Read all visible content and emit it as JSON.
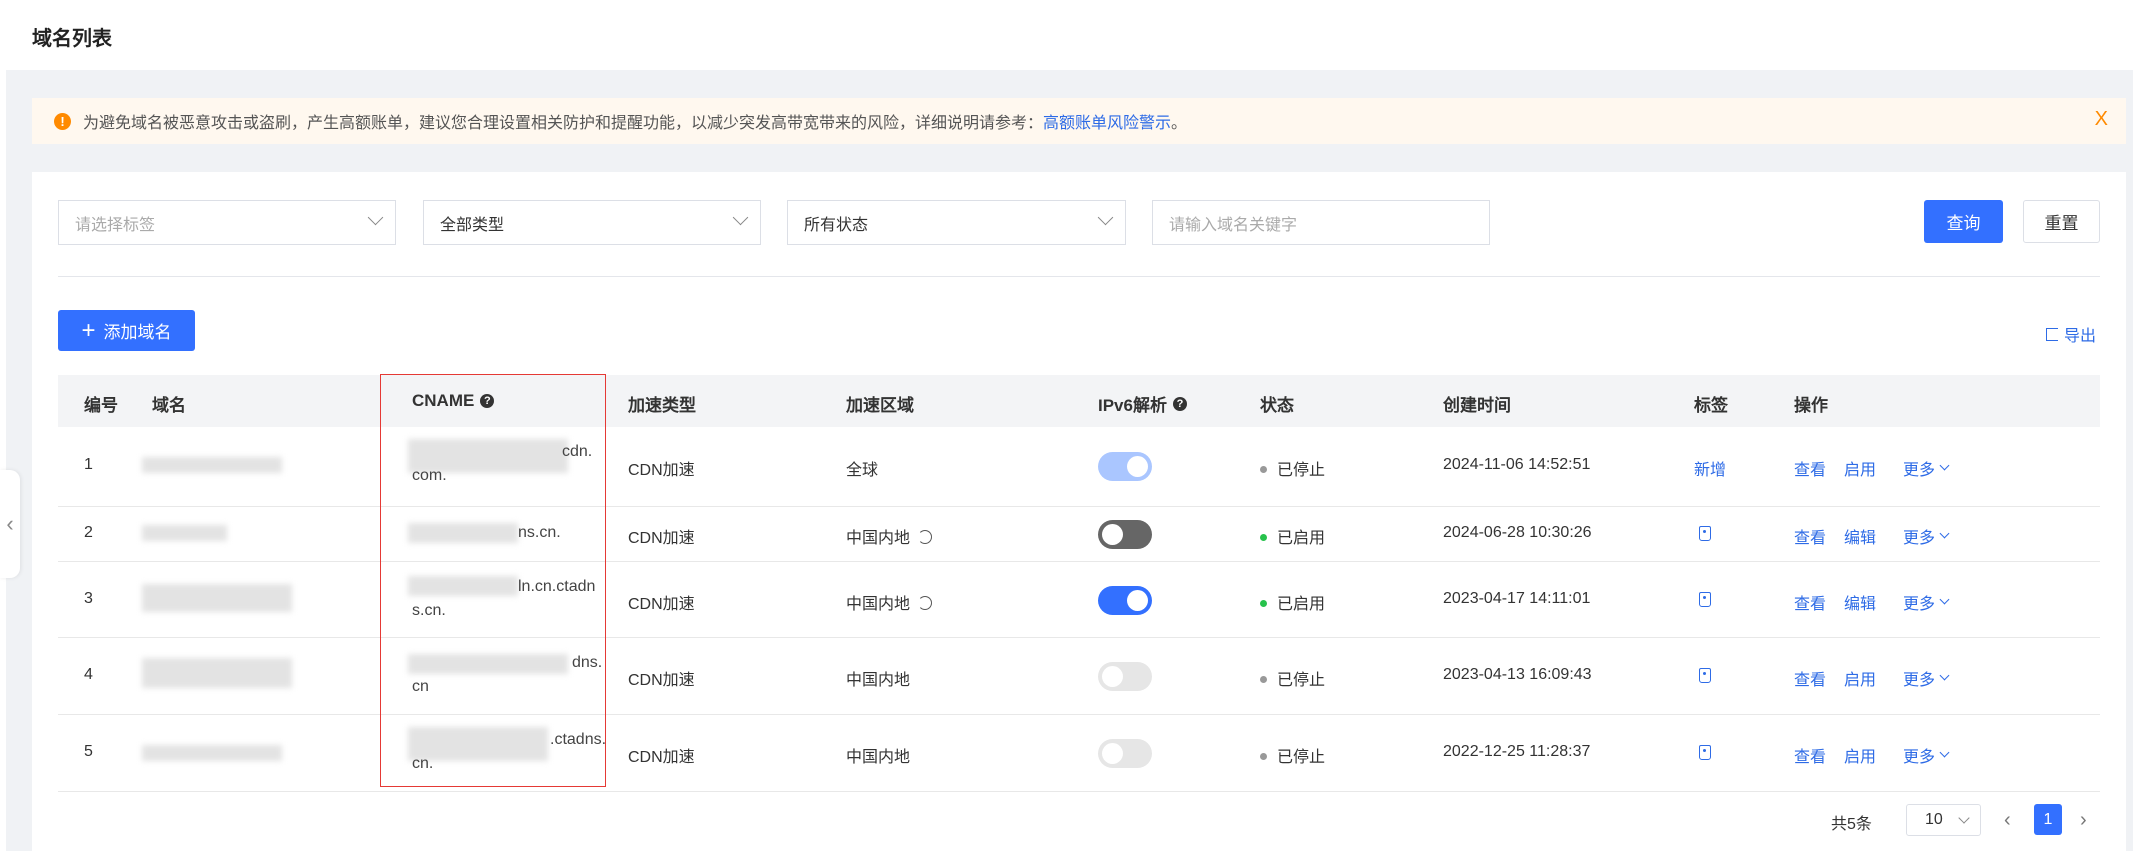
{
  "header": {
    "title": "域名列表"
  },
  "alert": {
    "text": "为避免域名被恶意攻击或盗刷，产生高额账单，建议您合理设置相关防护和提醒功能，以减少突发高带宽带来的风险，详细说明请参考：",
    "link": "高额账单风险警示",
    "suffix": "。",
    "icon": "!",
    "close": "X"
  },
  "filters": {
    "tag_placeholder": "请选择标签",
    "type_value": "全部类型",
    "status_value": "所有状态",
    "keyword_placeholder": "请输入域名关键字",
    "query_label": "查询",
    "reset_label": "重置"
  },
  "toolbar": {
    "add_label": "添加域名",
    "add_icon": "+",
    "export_label": "导出"
  },
  "table": {
    "headers": {
      "no": "编号",
      "domain": "域名",
      "cname": "CNAME",
      "type": "加速类型",
      "region": "加速区域",
      "ipv6": "IPv6解析",
      "status": "状态",
      "created": "创建时间",
      "tag": "标签",
      "actions": "操作"
    },
    "help_icon": "?",
    "rows": [
      {
        "no": "1",
        "cname_line1": "cdn.",
        "cname_line2": "com.",
        "type": "CDN加速",
        "region": "全球",
        "ipv6": "on-disabled",
        "status": "已停止",
        "status_color": "#999999",
        "created": "2024-11-06 14:52:51",
        "tag": "新增",
        "view": "查看",
        "action2": "启用",
        "more": "更多"
      },
      {
        "no": "2",
        "cname_line1": "ns.cn.",
        "cname_line2": "",
        "type": "CDN加速",
        "region": "中国内地",
        "ipv6": "off",
        "status": "已启用",
        "status_color": "#27c24c",
        "created": "2024-06-28 10:30:26",
        "tag": "",
        "view": "查看",
        "action2": "编辑",
        "more": "更多"
      },
      {
        "no": "3",
        "cname_line1": "ln.cn.ctadn",
        "cname_line2": "s.cn.",
        "type": "CDN加速",
        "region": "中国内地",
        "ipv6": "on",
        "status": "已启用",
        "status_color": "#27c24c",
        "created": "2023-04-17 14:11:01",
        "tag": "",
        "view": "查看",
        "action2": "编辑",
        "more": "更多"
      },
      {
        "no": "4",
        "cname_line1": "dns.",
        "cname_line2": "cn",
        "type": "CDN加速",
        "region": "中国内地",
        "ipv6": "off-light",
        "status": "已停止",
        "status_color": "#999999",
        "created": "2023-04-13 16:09:43",
        "tag": "",
        "view": "查看",
        "action2": "启用",
        "more": "更多"
      },
      {
        "no": "5",
        "cname_line1": ".ctadns.",
        "cname_line2": "cn.",
        "type": "CDN加速",
        "region": "中国内地",
        "ipv6": "off-light",
        "status": "已停止",
        "status_color": "#999999",
        "created": "2022-12-25 11:28:37",
        "tag": "",
        "view": "查看",
        "action2": "启用",
        "more": "更多"
      }
    ]
  },
  "pagination": {
    "total": "共5条",
    "page_size": "10",
    "current_page": "1",
    "prev": "‹",
    "next": "›"
  },
  "colors": {
    "primary": "#3370ff",
    "link": "#2e6be6",
    "warning": "#ff8a00",
    "highlight": "#e53935"
  }
}
